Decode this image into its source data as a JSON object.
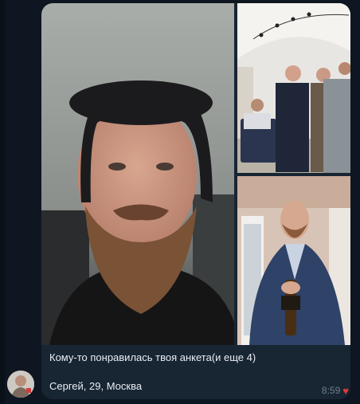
{
  "message": {
    "caption_line1": "Кому-то понравилась твоя анкета(и еще 4)",
    "caption_line2": "Сергей, 29, Москва",
    "time": "8:59",
    "reaction": "heart-icon"
  },
  "photos": [
    {
      "description_name": "main-portrait-photo"
    },
    {
      "description_name": "event-photo"
    },
    {
      "description_name": "champagne-photo"
    }
  ],
  "colors": {
    "background": "#0e1621",
    "bubble": "#182533",
    "text": "#e9eef4",
    "time": "#6d7f8f",
    "reaction": "#e53935"
  }
}
